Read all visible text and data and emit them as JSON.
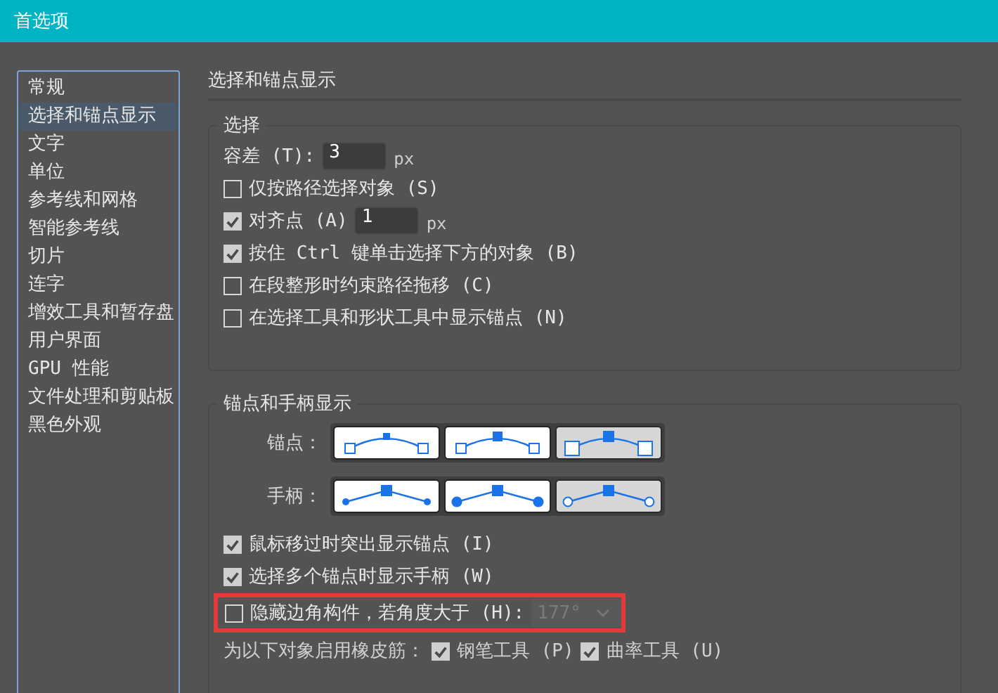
{
  "window": {
    "title": "首选项"
  },
  "sidebar": {
    "items": [
      {
        "label": "常规",
        "selected": false
      },
      {
        "label": "选择和锚点显示",
        "selected": true
      },
      {
        "label": "文字",
        "selected": false
      },
      {
        "label": "单位",
        "selected": false
      },
      {
        "label": "参考线和网格",
        "selected": false
      },
      {
        "label": "智能参考线",
        "selected": false
      },
      {
        "label": "切片",
        "selected": false
      },
      {
        "label": "连字",
        "selected": false
      },
      {
        "label": "增效工具和暂存盘",
        "selected": false
      },
      {
        "label": "用户界面",
        "selected": false
      },
      {
        "label": "GPU 性能",
        "selected": false
      },
      {
        "label": "文件处理和剪贴板",
        "selected": false
      },
      {
        "label": "黑色外观",
        "selected": false
      }
    ]
  },
  "heading": "选择和锚点显示",
  "selection": {
    "title": "选择",
    "tolerance": {
      "label": "容差 (T):",
      "value": "3",
      "unit": "px"
    },
    "options": [
      {
        "label": "仅按路径选择对象 (S)",
        "checked": false
      },
      {
        "label": "对齐点 (A)",
        "checked": true,
        "field": {
          "value": "1",
          "unit": "px"
        }
      },
      {
        "label": "按住 Ctrl 键单击选择下方的对象 (B)",
        "checked": true
      },
      {
        "label": "在段整形时约束路径拖移 (C)",
        "checked": false
      },
      {
        "label": "在选择工具和形状工具中显示锚点 (N)",
        "checked": false
      }
    ]
  },
  "anchor_display": {
    "title": "锚点和手柄显示",
    "anchors": {
      "label": "锚点：",
      "styles": [
        {
          "kind": "small",
          "selected": false
        },
        {
          "kind": "medium",
          "selected": false
        },
        {
          "kind": "large",
          "selected": true
        }
      ]
    },
    "handles": {
      "label": "手柄：",
      "styles": [
        {
          "kind": "small",
          "selected": false
        },
        {
          "kind": "large",
          "selected": false
        },
        {
          "kind": "hollow",
          "selected": true
        }
      ]
    },
    "options": [
      {
        "label": "鼠标移过时突出显示锚点 (I)",
        "checked": true
      },
      {
        "label": "选择多个锚点时显示手柄 (W)",
        "checked": true
      }
    ],
    "hide_corner": {
      "label": "隐藏边角构件，若角度大于 (H):",
      "checked": false,
      "highlighted": true,
      "dropdown": {
        "value": "177°",
        "disabled": true
      }
    },
    "rubber_band": {
      "label": "为以下对象启用橡皮筋：",
      "tools": [
        {
          "label": "钢笔工具 (P)",
          "checked": true
        },
        {
          "label": "曲率工具 (U)",
          "checked": true
        }
      ]
    }
  }
}
